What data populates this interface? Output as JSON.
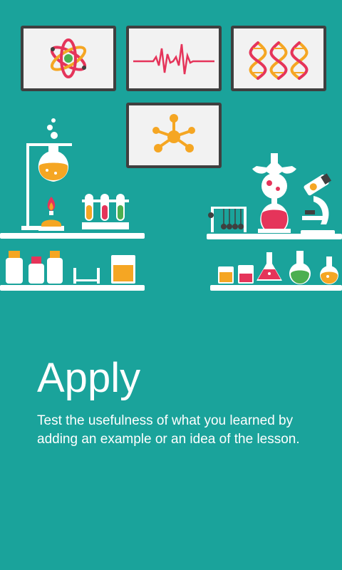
{
  "onboarding": {
    "title": "Apply",
    "description": "Test the usefulness of what you learned by adding an example or an idea of the lesson."
  },
  "illustration": {
    "frames": [
      "atom-icon",
      "heartbeat-icon",
      "dna-icon",
      "molecule-icon"
    ],
    "colors": {
      "background": "#1aa39b",
      "orange": "#f5a623",
      "red": "#e5345a",
      "green": "#4caf50",
      "dark": "#3f3f3f",
      "white": "#ffffff"
    }
  }
}
